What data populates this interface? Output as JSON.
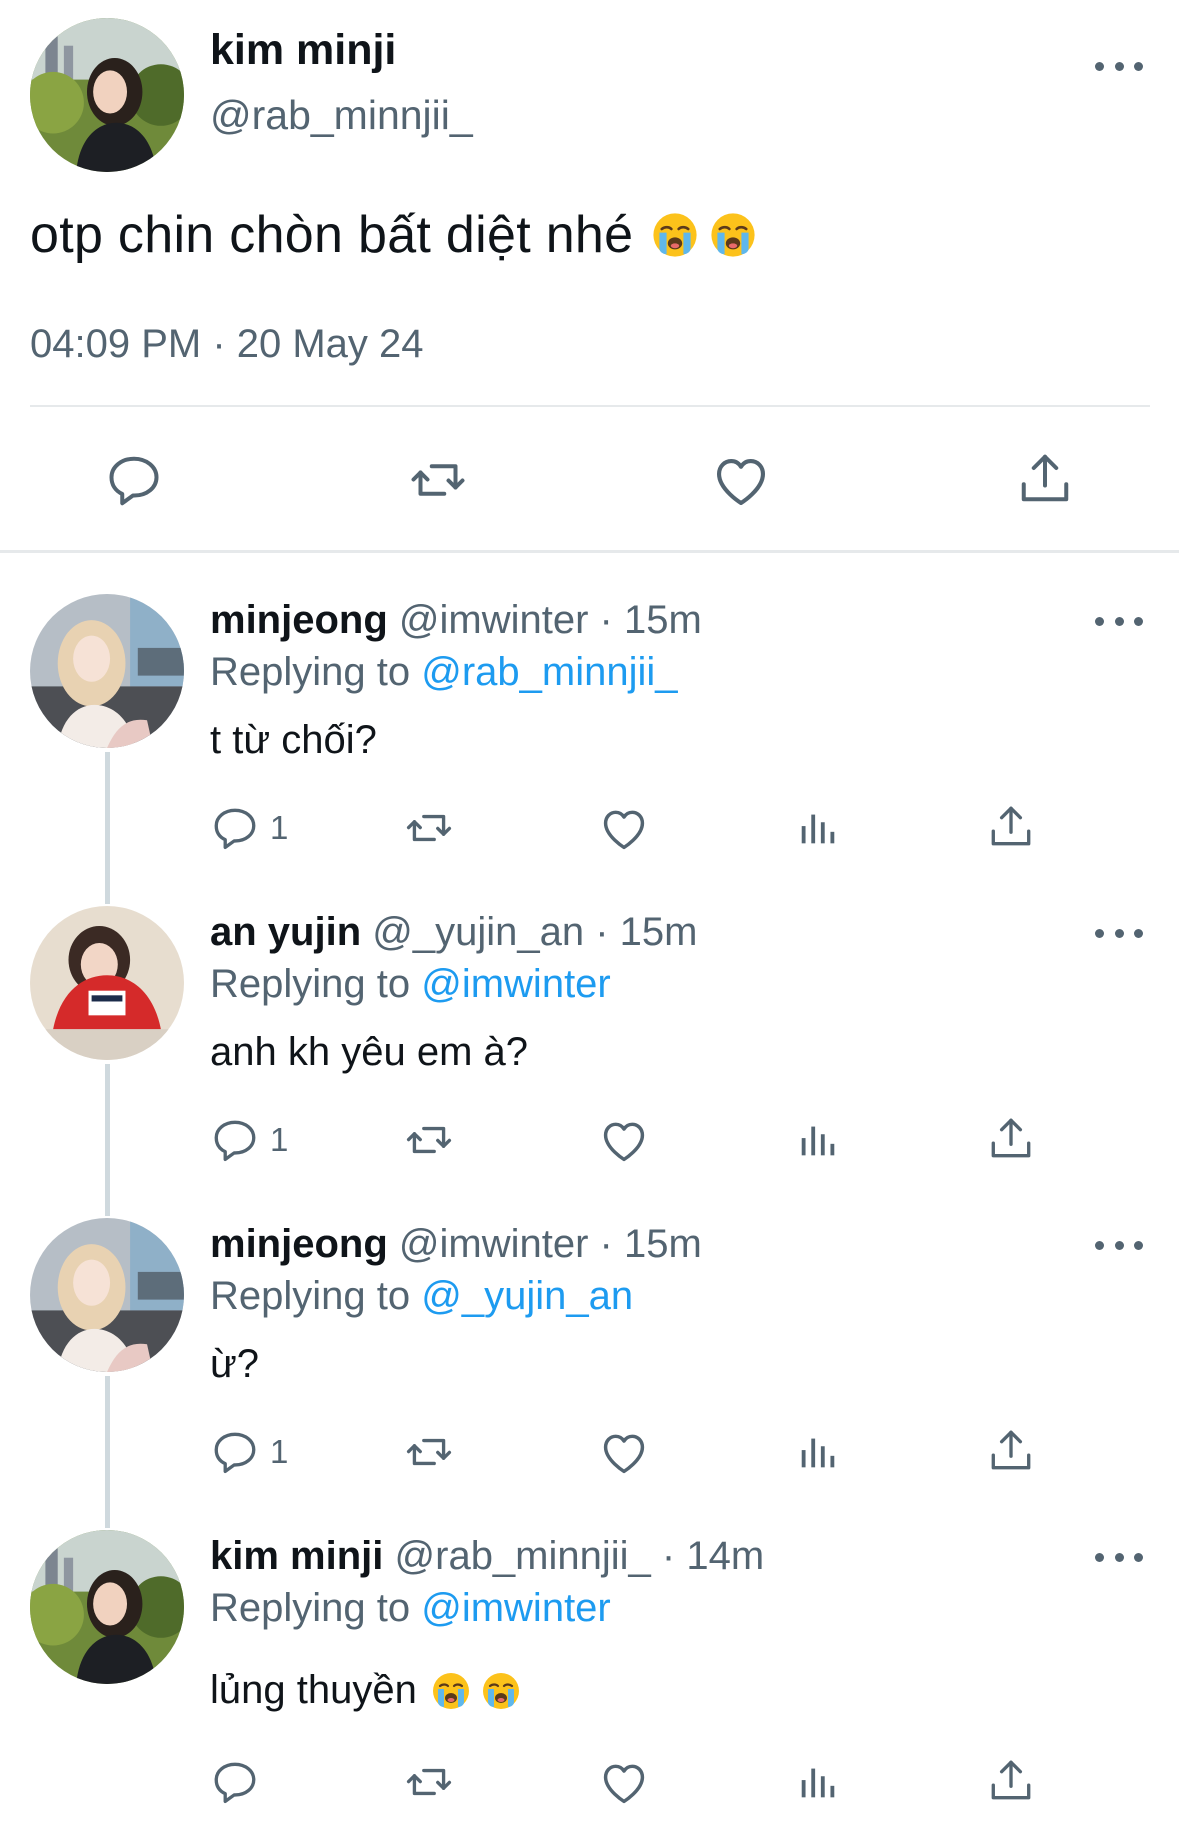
{
  "main_tweet": {
    "name": "kim minji",
    "handle": "@rab_minnjii_",
    "text": "otp chin chòn bất diệt nhé",
    "emoji_count": 2,
    "emoji_icon": "loudly-crying-face-emoji",
    "timestamp": "04:09 PM · 20 May 24",
    "actions": [
      "reply-icon",
      "retweet-icon",
      "like-icon",
      "share-icon"
    ]
  },
  "replies": [
    {
      "name": "minjeong",
      "meta": "@imwinter · 15m",
      "replying_prefix": "Replying to ",
      "replying_to": "@rab_minnjii_",
      "text": "t từ chối?",
      "reply_count": "1",
      "avatar": "minjeong-avatar"
    },
    {
      "name": "an yujin",
      "meta": "@_yujin_an · 15m",
      "replying_prefix": "Replying to ",
      "replying_to": "@imwinter",
      "text": "anh kh yêu em à?",
      "reply_count": "1",
      "avatar": "yujin-avatar"
    },
    {
      "name": "minjeong",
      "meta": "@imwinter · 15m",
      "replying_prefix": "Replying to ",
      "replying_to": "@_yujin_an",
      "text": "ừ?",
      "reply_count": "1",
      "avatar": "minjeong-avatar"
    },
    {
      "name": "kim minji",
      "meta": "@rab_minnjii_ · 14m",
      "replying_prefix": "Replying to ",
      "replying_to": "@imwinter",
      "text": "lủng thuyền",
      "reply_count": "",
      "emoji_count": 2,
      "avatar": "minji-avatar"
    }
  ],
  "colors": {
    "text": "#0f1419",
    "secondary": "#536471",
    "link": "#1d9bf0",
    "divider": "#e6e9eb",
    "thread_line": "#cfd9de"
  }
}
